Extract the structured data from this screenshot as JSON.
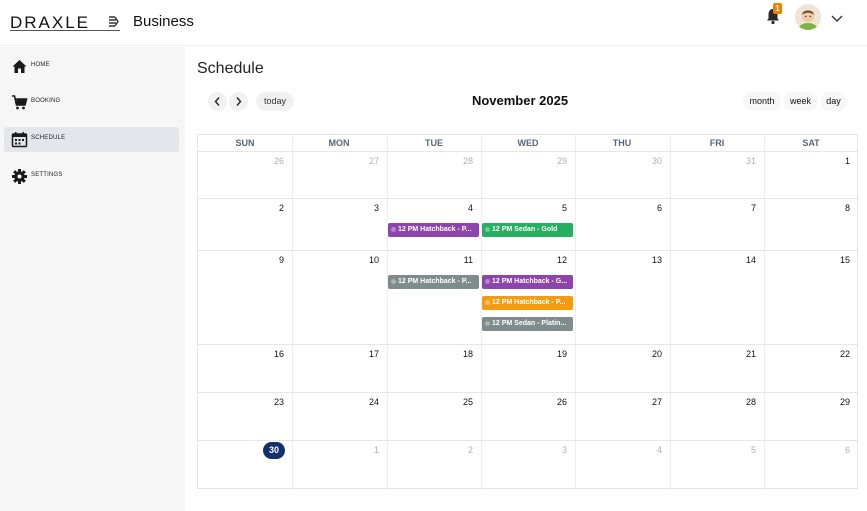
{
  "header": {
    "logo_text": "DRAXLE",
    "brand": "Business",
    "notification_count": "1"
  },
  "sidebar": {
    "items": [
      {
        "label": "HOME",
        "icon": "home-icon"
      },
      {
        "label": "BOOKING",
        "icon": "cart-icon"
      },
      {
        "label": "SCHEDULE",
        "icon": "calendar-icon",
        "active": true
      },
      {
        "label": "SETTINGS",
        "icon": "gear-icon"
      }
    ]
  },
  "page": {
    "title": "Schedule"
  },
  "toolbar": {
    "today_label": "today",
    "month_title": "November 2025",
    "views": [
      "month",
      "week",
      "day"
    ]
  },
  "calendar": {
    "weekdays": [
      "SUN",
      "MON",
      "TUE",
      "WED",
      "THU",
      "FRI",
      "SAT"
    ],
    "weeks": [
      [
        "26",
        "27",
        "28",
        "29",
        "30",
        "31",
        "1"
      ],
      [
        "2",
        "3",
        "4",
        "5",
        "6",
        "7",
        "8"
      ],
      [
        "9",
        "10",
        "11",
        "12",
        "13",
        "14",
        "15"
      ],
      [
        "16",
        "17",
        "18",
        "19",
        "20",
        "21",
        "22"
      ],
      [
        "23",
        "24",
        "25",
        "26",
        "27",
        "28",
        "29"
      ],
      [
        "30",
        "1",
        "2",
        "3",
        "4",
        "5",
        "6"
      ]
    ],
    "today": "30",
    "events": [
      {
        "day": "4",
        "label": "12 PM Hatchback - P...",
        "color": "#8e44ad"
      },
      {
        "day": "5",
        "label": "12 PM Sedan - Gold",
        "color": "#27ae60"
      },
      {
        "day": "11",
        "label": "12 PM Hatchback - P...",
        "color": "#7f8c8d"
      },
      {
        "day": "12",
        "label": "12 PM Hatchback - G...",
        "color": "#8e44ad"
      },
      {
        "day": "12",
        "label": "12 PM Hatchback - P...",
        "color": "#f39c12"
      },
      {
        "day": "12",
        "label": "12 PM Sedan - Platin...",
        "color": "#7f8c8d"
      }
    ]
  },
  "colors": {
    "today_bg": "#12306b",
    "badge": "#f57c00",
    "sidebar_bg": "#f6f6f7",
    "active_nav": "#e4e6eb"
  }
}
